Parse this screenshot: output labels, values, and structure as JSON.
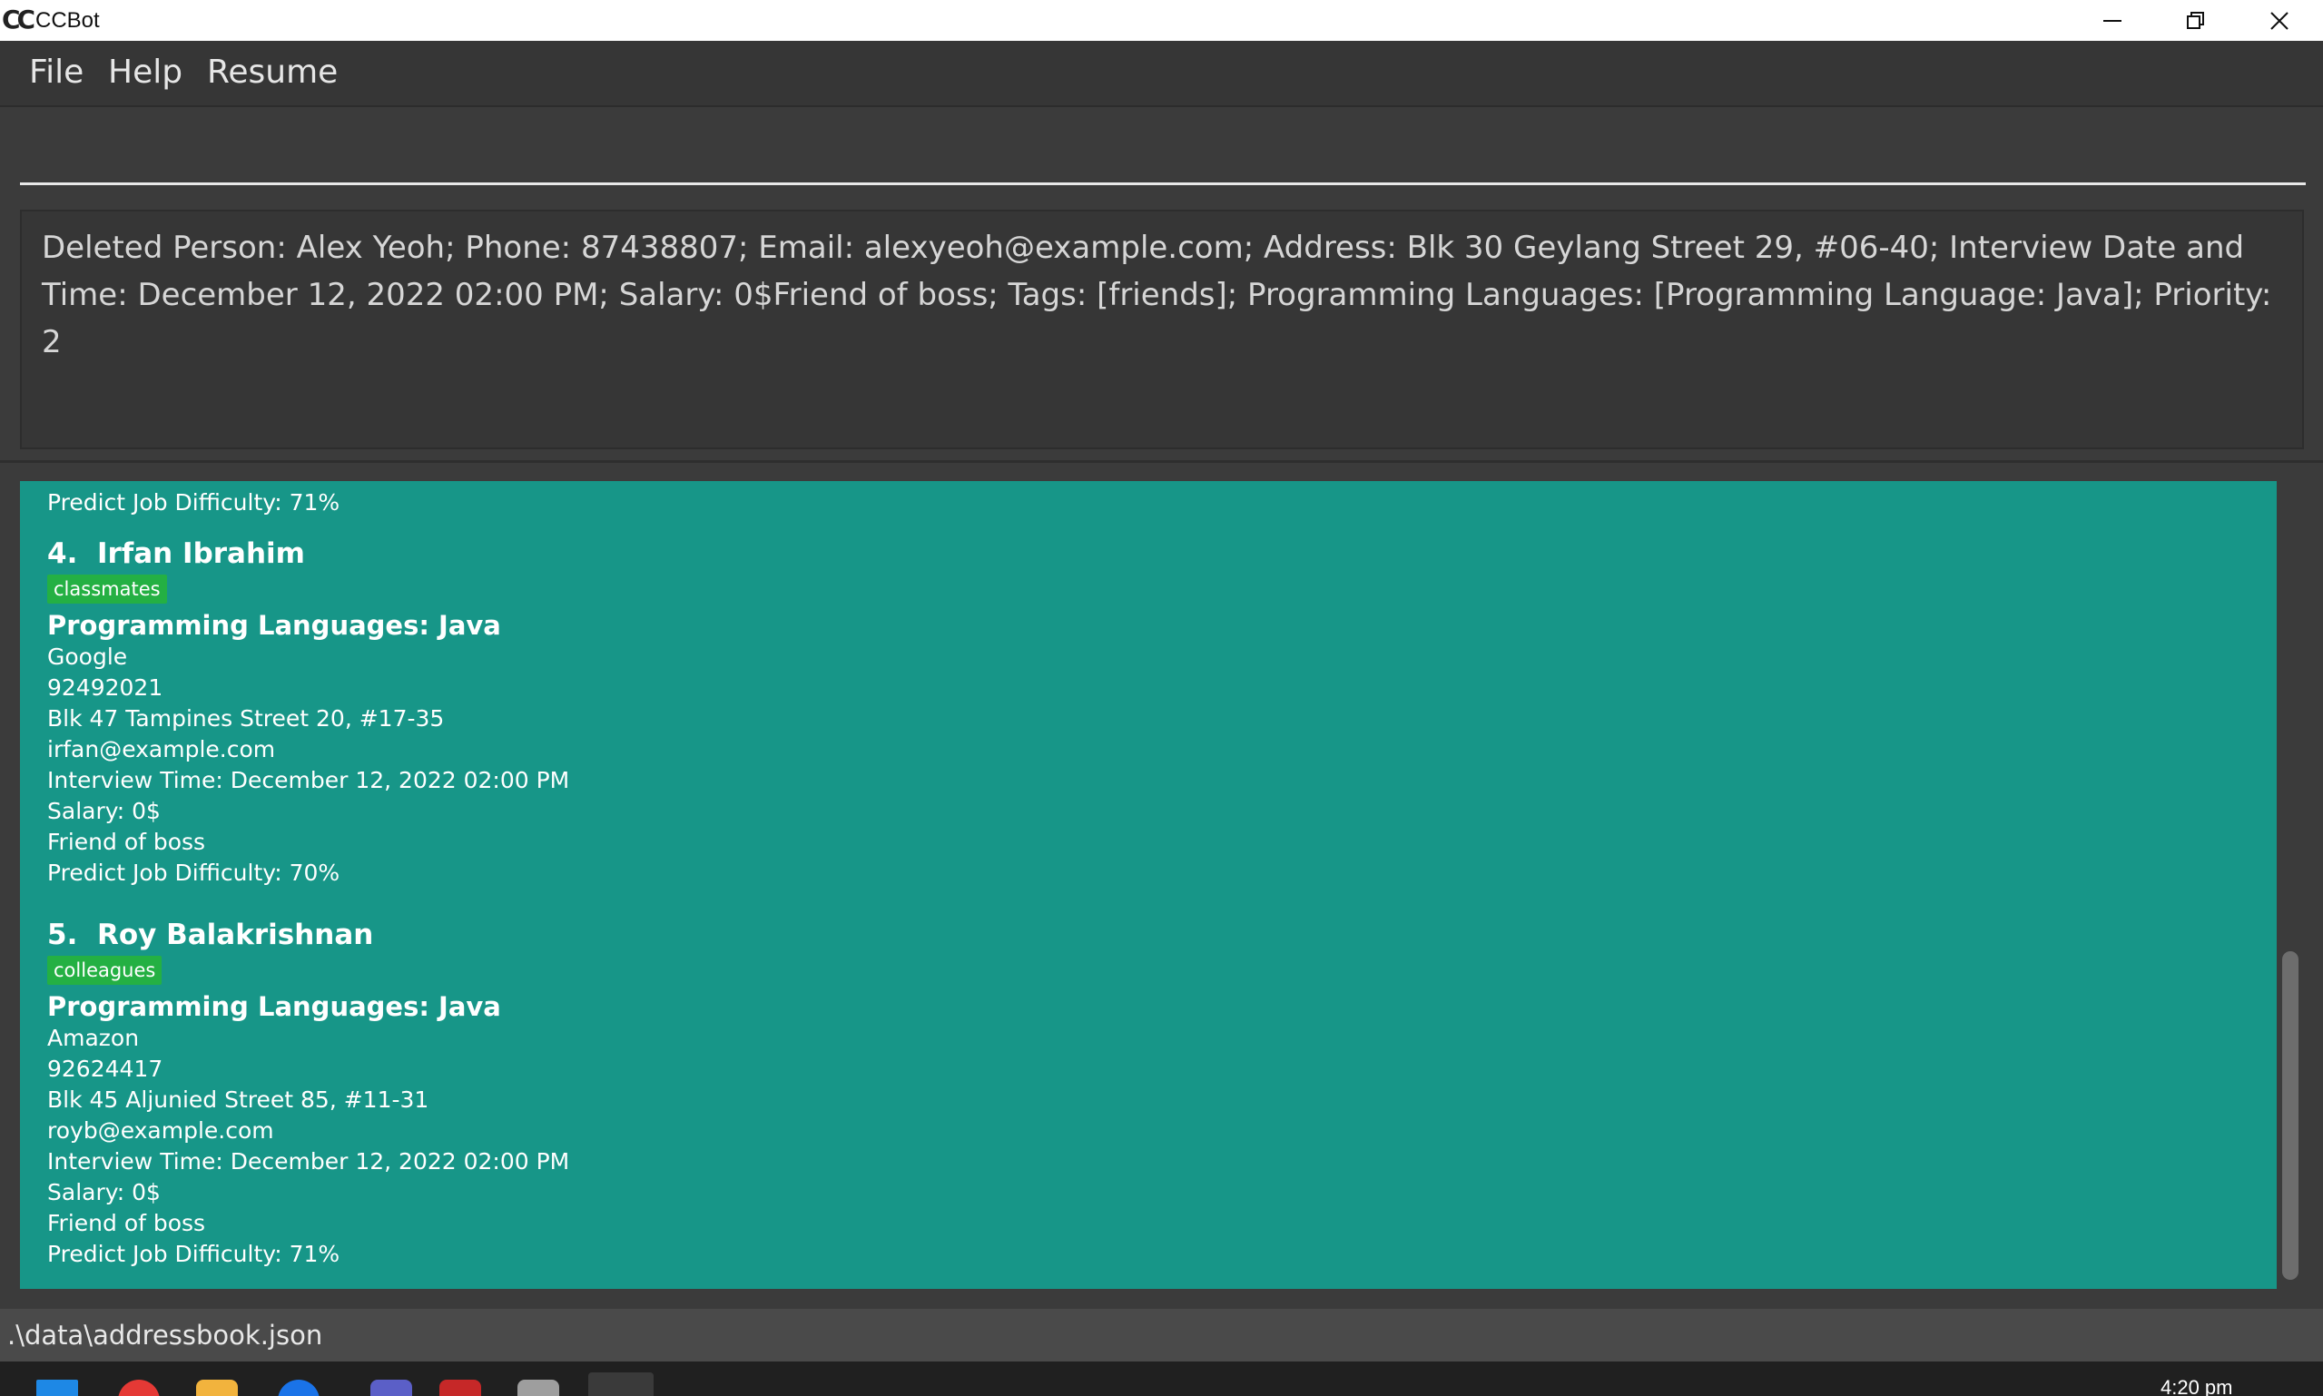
{
  "window": {
    "title": "CCBot",
    "logo_text": "CC"
  },
  "menu": {
    "items": [
      "File",
      "Help",
      "Resume"
    ]
  },
  "command": {
    "value": "",
    "placeholder": ""
  },
  "result": {
    "text": "Deleted Person: Alex Yeoh; Phone: 87438807; Email: alexyeoh@example.com; Address: Blk 30 Geylang Street 29, #06-40; Interview Date and Time: December 12, 2022 02:00 PM; Salary: 0$Friend of boss; Tags: [friends]; Programming Languages: [Programming Language: Java]; Priority: 2"
  },
  "list": {
    "prev_tail": "Predict Job Difficulty: 71%",
    "persons": [
      {
        "index": "4.",
        "name": "Irfan Ibrahim",
        "tag": "classmates",
        "languages": "Programming Languages: Java",
        "company": "Google",
        "phone": "92492021",
        "address": "Blk 47 Tampines Street 20, #17-35",
        "email": "irfan@example.com",
        "interview": "Interview Time: December 12, 2022 02:00 PM",
        "salary": "Salary: 0$",
        "remark": "Friend of boss",
        "difficulty": "Predict Job Difficulty: 70%"
      },
      {
        "index": "5.",
        "name": "Roy Balakrishnan",
        "tag": "colleagues",
        "languages": "Programming Languages: Java",
        "company": "Amazon",
        "phone": "92624417",
        "address": "Blk 45 Aljunied Street 85, #11-31",
        "email": "royb@example.com",
        "interview": "Interview Time: December 12, 2022 02:00 PM",
        "salary": "Salary: 0$",
        "remark": "Friend of boss",
        "difficulty": "Predict Job Difficulty: 71%"
      }
    ]
  },
  "status": {
    "path": ".\\data\\addressbook.json"
  },
  "taskbar": {
    "clock": "4:20 pm"
  },
  "colors": {
    "list_background": "#179688",
    "tag_background": "#24b043",
    "app_background": "#3b3b3b"
  }
}
